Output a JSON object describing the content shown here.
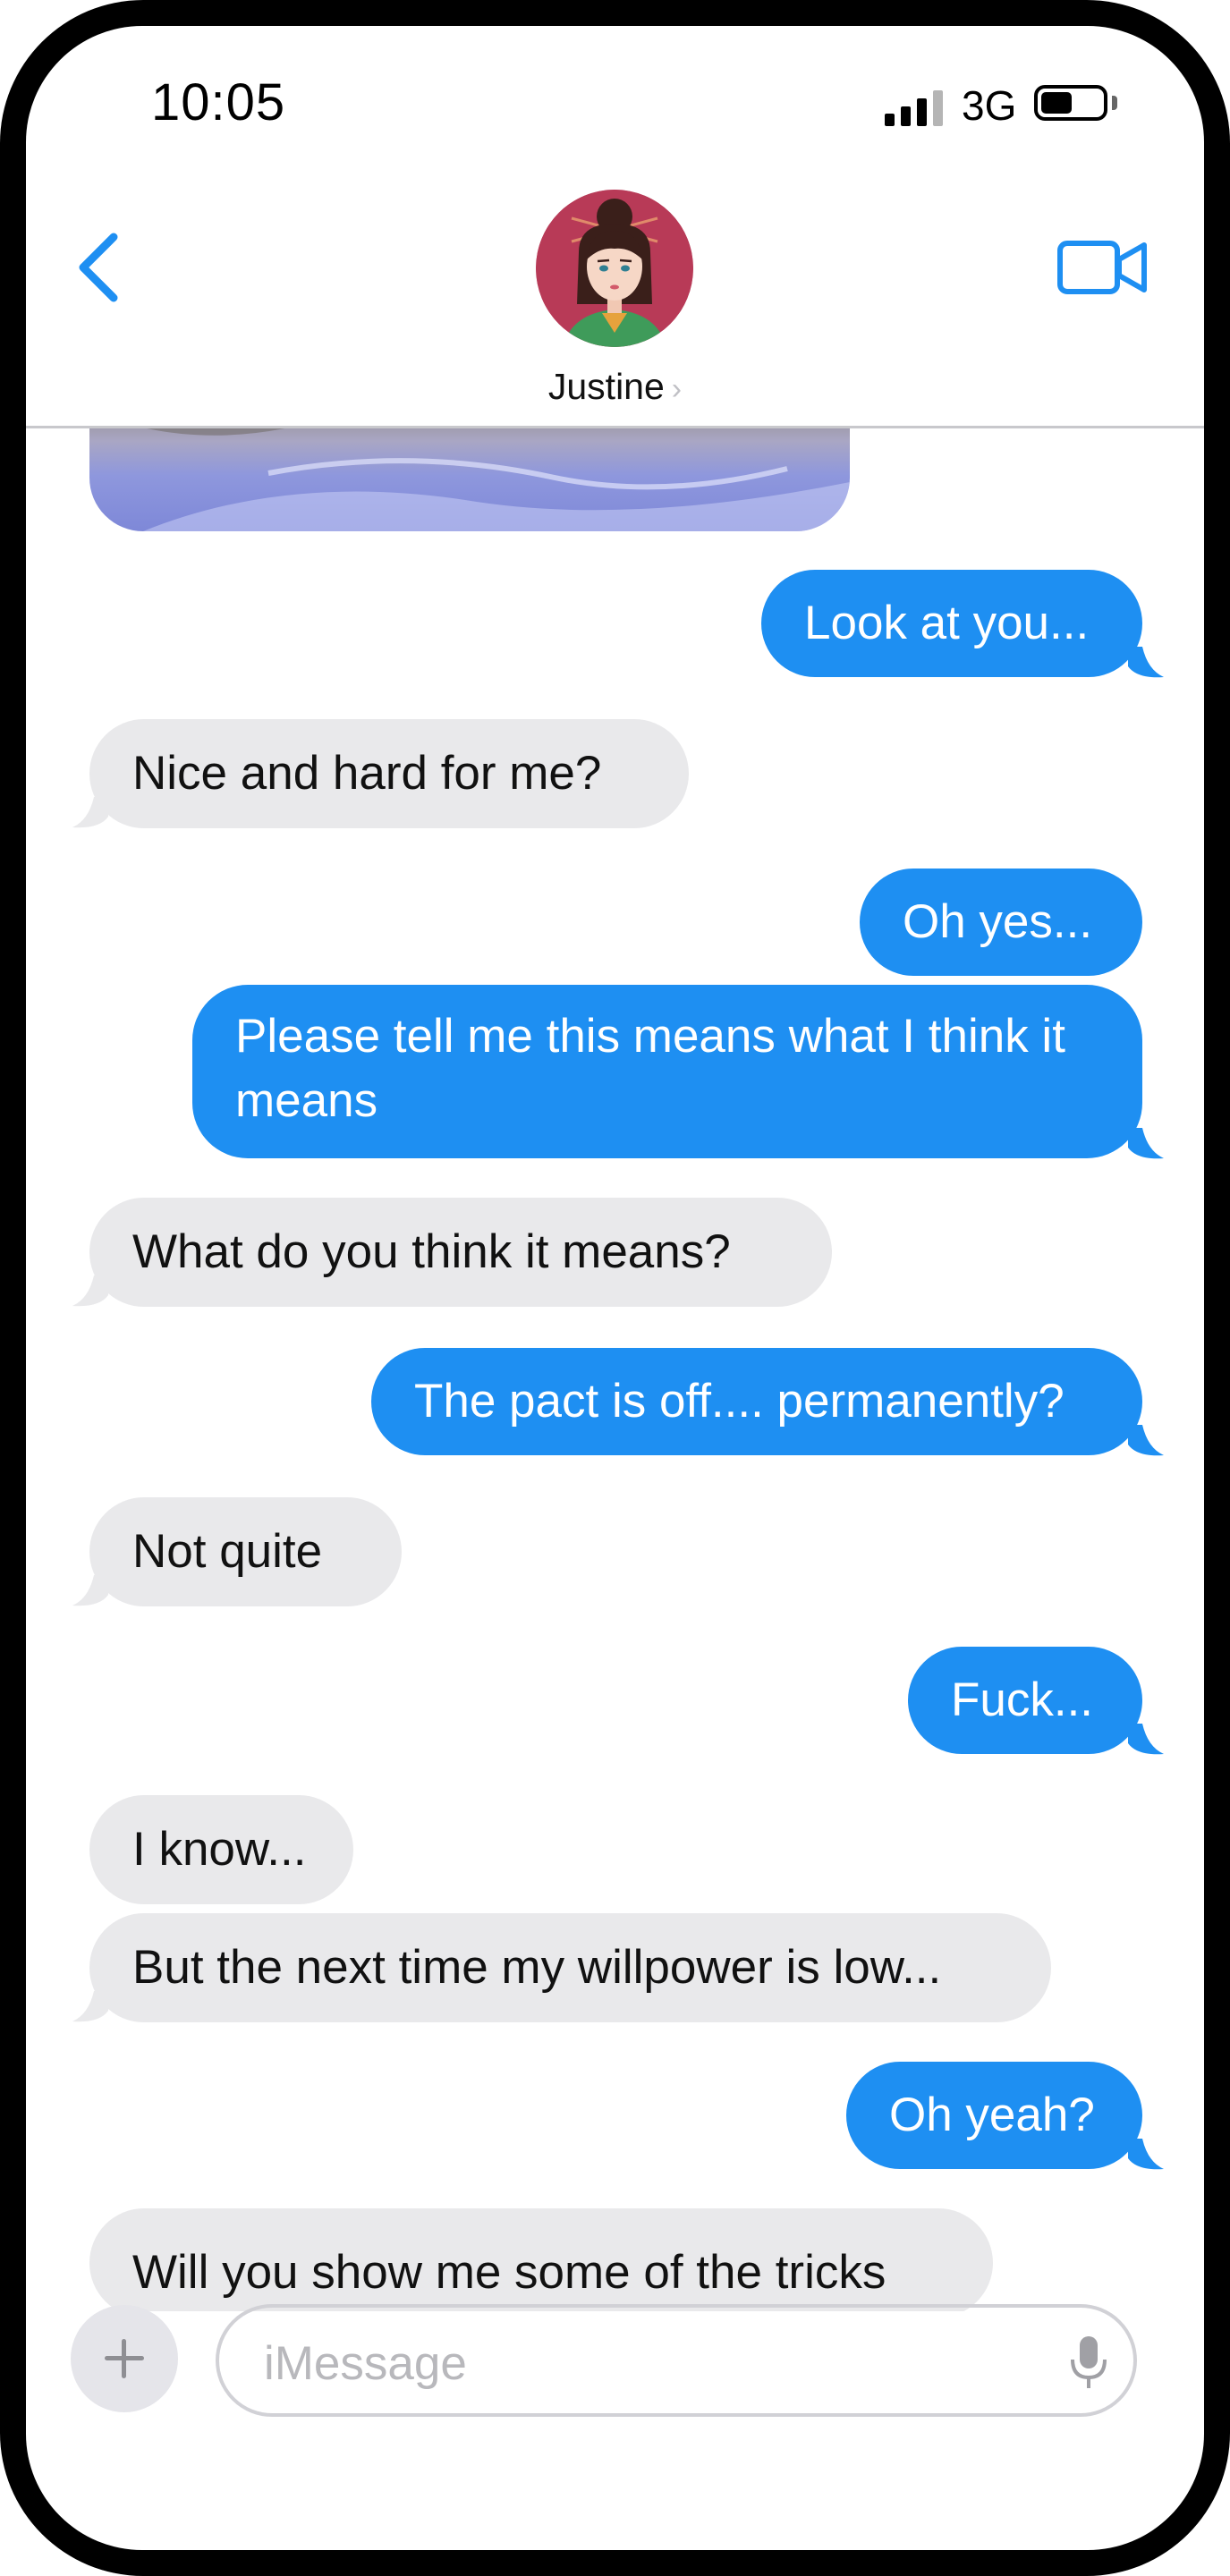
{
  "status_bar": {
    "time": "10:05",
    "network": "3G"
  },
  "header": {
    "contact_name": "Justine",
    "chevron": "›"
  },
  "icons": {
    "back": "chevron-left-icon",
    "video": "video-camera-icon",
    "plus": "plus-icon",
    "mic": "microphone-icon"
  },
  "colors": {
    "accent": "#1e8ff2",
    "outgoing": "#1e8ff2",
    "incoming": "#e9e9eb",
    "avatar_bg": "#b83a57"
  },
  "messages": [
    {
      "direction": "out",
      "text": "Look at you..."
    },
    {
      "direction": "in",
      "text": "Nice and hard for me?"
    },
    {
      "direction": "out",
      "text": "Oh yes..."
    },
    {
      "direction": "out",
      "text": "Please tell me this means what I think it means"
    },
    {
      "direction": "in",
      "text": "What do you think it means?"
    },
    {
      "direction": "out",
      "text": "The pact is off.... permanently?"
    },
    {
      "direction": "in",
      "text": "Not quite"
    },
    {
      "direction": "out",
      "text": "Fuck..."
    },
    {
      "direction": "in",
      "text": "I know..."
    },
    {
      "direction": "in",
      "text": "But the next time my willpower is low..."
    },
    {
      "direction": "out",
      "text": "Oh yeah?"
    },
    {
      "direction": "in",
      "text": "Will you show me some of the tricks"
    }
  ],
  "composer": {
    "placeholder": "iMessage"
  }
}
